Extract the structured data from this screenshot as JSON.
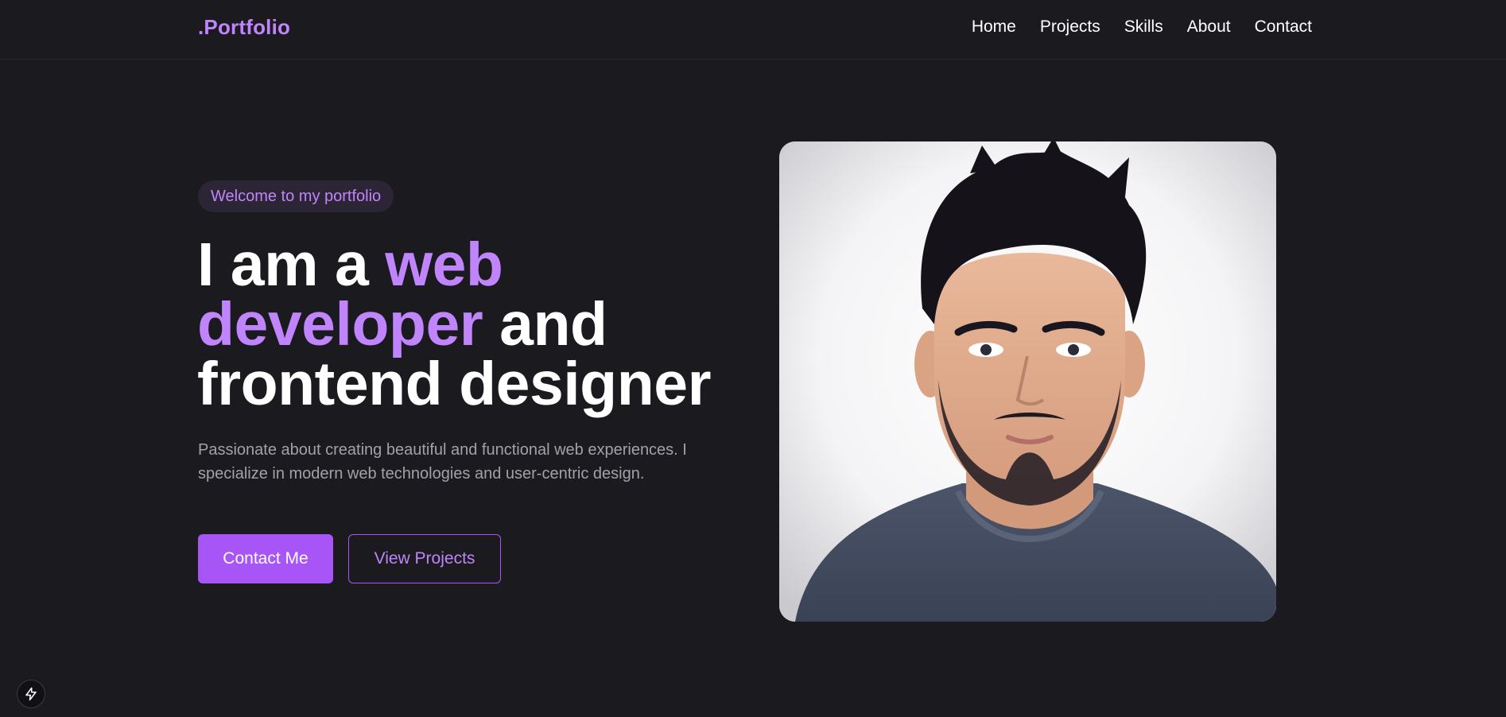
{
  "nav": {
    "brand": ".Portfolio",
    "links": [
      "Home",
      "Projects",
      "Skills",
      "About",
      "Contact"
    ]
  },
  "hero": {
    "badge": "Welcome to my portfolio",
    "headline": {
      "part1": "I am a ",
      "accent1": "web",
      "accent2": "developer",
      "part2": " and",
      "part3": "frontend designer"
    },
    "description": "Passionate about creating beautiful and functional web experiences. I specialize in modern web technologies and user-centric design.",
    "primary_button": "Contact Me",
    "secondary_button": "View Projects"
  },
  "icons": {
    "corner_badge": "bolt-icon"
  },
  "colors": {
    "background": "#1b1b1f",
    "accent": "#c084fc",
    "button": "#a855f7",
    "muted_text": "#a1a1aa"
  }
}
